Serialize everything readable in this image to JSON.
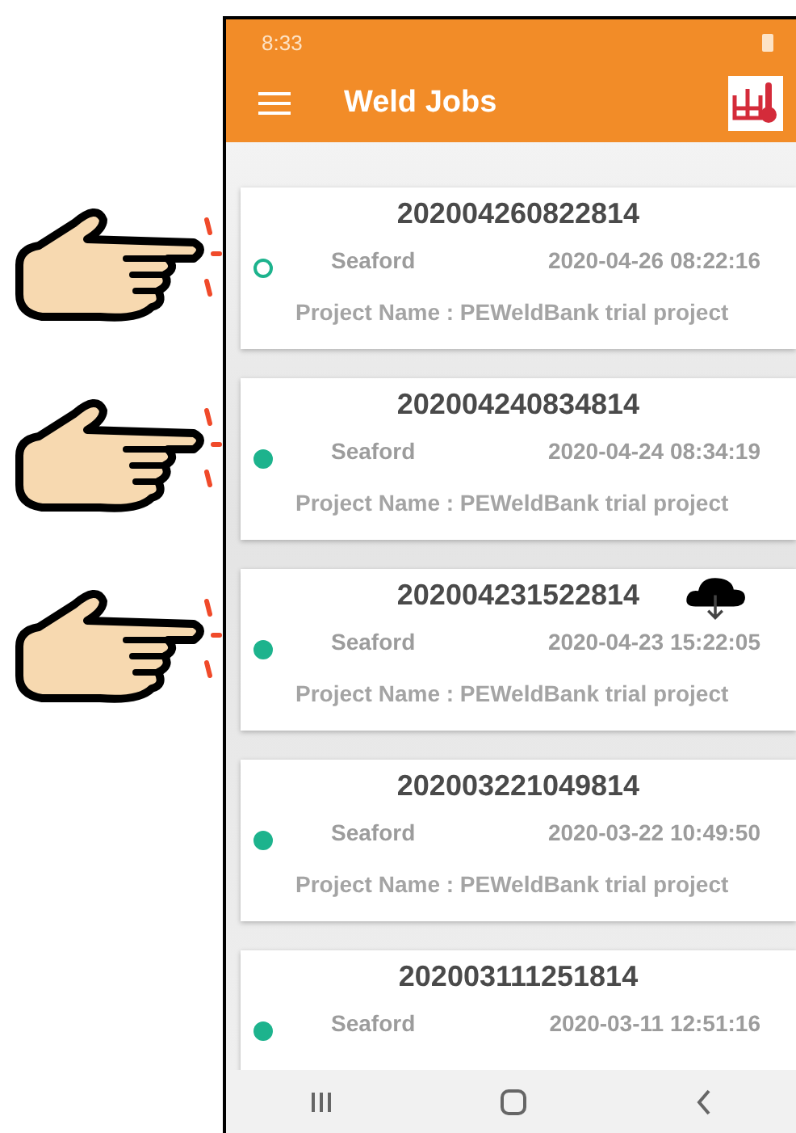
{
  "status_bar": {
    "time": "8:33"
  },
  "app_bar": {
    "title": "Weld Jobs"
  },
  "jobs": [
    {
      "number": "202004260822814",
      "location": "Seaford",
      "datetime": "2020-04-26 08:22:16",
      "project": "Project Name : PEWeldBank trial project",
      "synced": false,
      "cloud": false,
      "pointed": true
    },
    {
      "number": "202004240834814",
      "location": "Seaford",
      "datetime": "2020-04-24 08:34:19",
      "project": "Project Name : PEWeldBank trial project",
      "synced": true,
      "cloud": false,
      "pointed": true
    },
    {
      "number": "202004231522814",
      "location": "Seaford",
      "datetime": "2020-04-23 15:22:05",
      "project": "Project Name : PEWeldBank trial project",
      "synced": true,
      "cloud": true,
      "pointed": true
    },
    {
      "number": "202003221049814",
      "location": "Seaford",
      "datetime": "2020-03-22 10:49:50",
      "project": "Project Name : PEWeldBank trial project",
      "synced": true,
      "cloud": false,
      "pointed": false
    },
    {
      "number": "202003111251814",
      "location": "Seaford",
      "datetime": "2020-03-11 12:51:16",
      "synced": true,
      "cloud": false,
      "pointed": false
    }
  ]
}
